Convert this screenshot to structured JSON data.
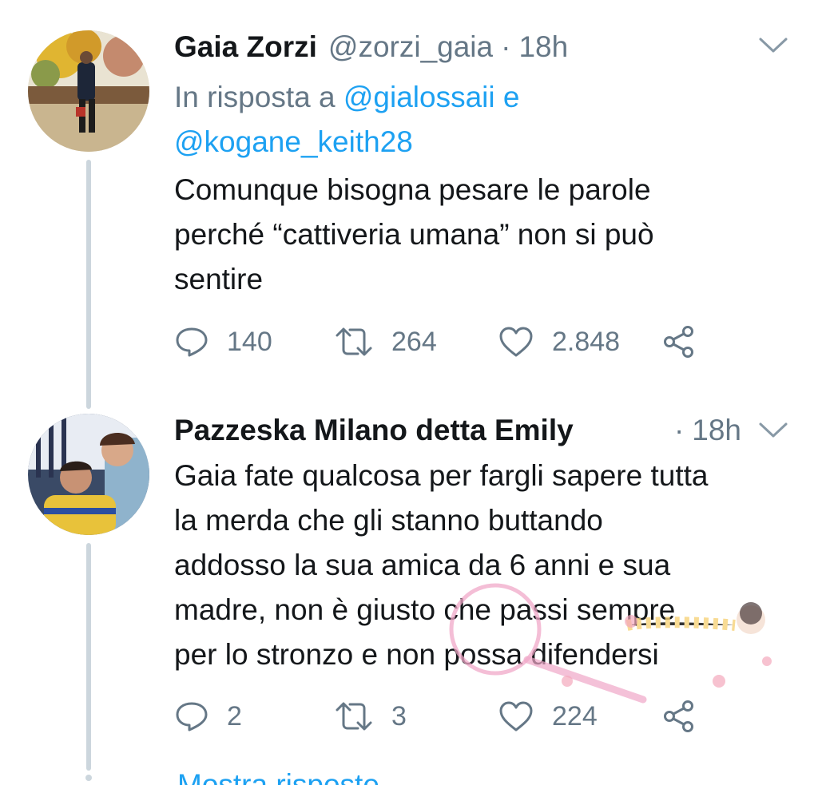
{
  "tweets": [
    {
      "author_name": "Gaia Zorzi",
      "handle": "@zorzi_gaia",
      "separator": "·",
      "time": "18h",
      "reply_prefix": "In risposta a",
      "reply_mention_1": "@gialossaii",
      "reply_conj": "e",
      "reply_mention_2": "@kogane_keith28",
      "text_line_1": "Comunque bisogna pesare le parole",
      "text_line_2": "perché “cattiveria umana” non si può",
      "text_line_3": "sentire",
      "replies": "140",
      "retweets": "264",
      "likes": "2.848"
    },
    {
      "author_name": "Pazzeska Milano detta Emily",
      "separator": "·",
      "time": "18h",
      "text_line_1": "Gaia fate qualcosa per fargli sapere tutta",
      "text_line_2": "la merda che gli stanno buttando",
      "text_line_3": "addosso la sua amica da 6 anni e sua",
      "text_line_4": "madre, non è giusto che passi sempre",
      "text_line_5": "per lo stronzo e non possa difendersi",
      "replies": "2",
      "retweets": "3",
      "likes": "224"
    }
  ],
  "footer": {
    "more_replies": "Mostra risposte"
  },
  "colors": {
    "link": "#1da1f2",
    "secondary": "#657786",
    "primary_text": "#14171a",
    "thread_line": "#ccd6dd"
  },
  "icons": [
    "chevron-down-icon",
    "reply-icon",
    "retweet-icon",
    "like-icon",
    "share-icon"
  ]
}
